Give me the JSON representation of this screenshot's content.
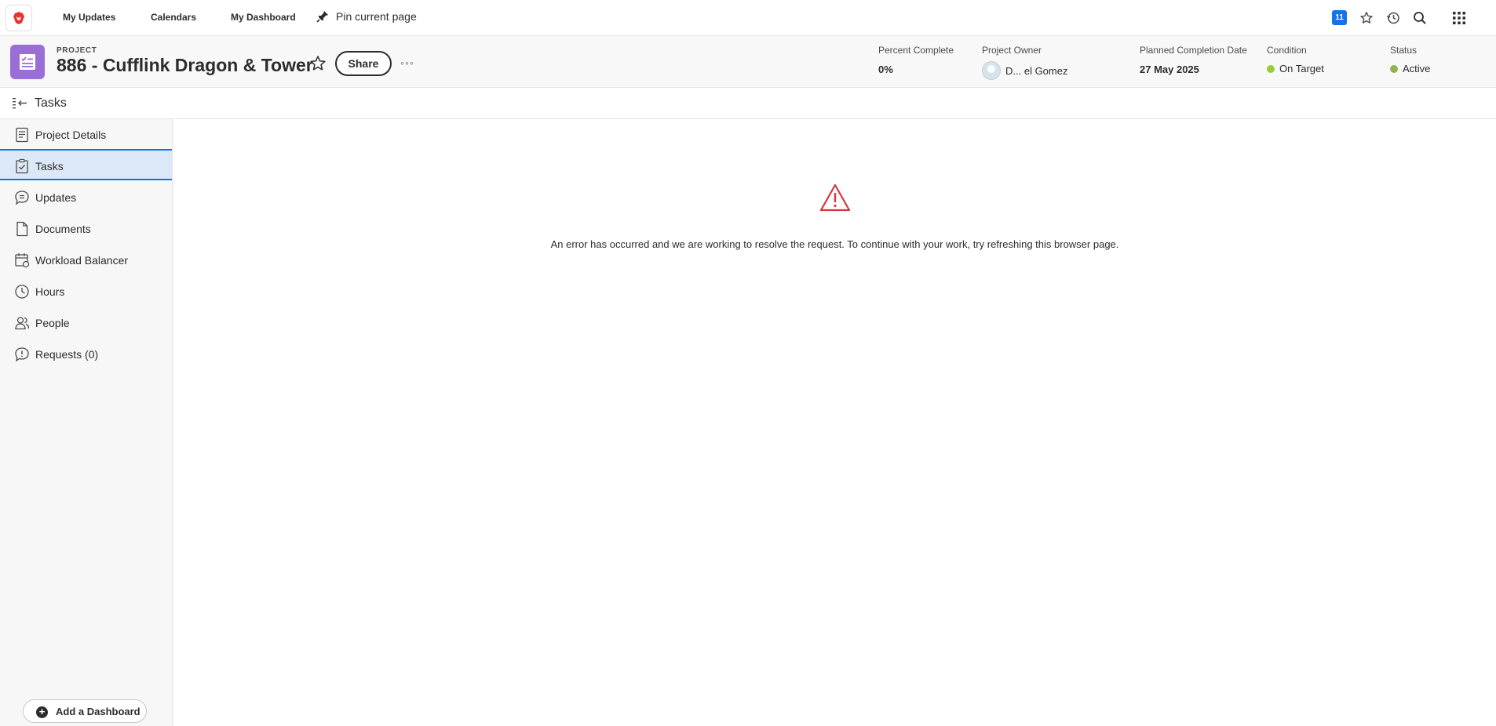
{
  "topnav": {
    "links": [
      "My Updates",
      "Calendars",
      "My Dashboard"
    ],
    "pin_label": "Pin current page",
    "badge": "11"
  },
  "project": {
    "kind": "PROJECT",
    "title": "886 - Cufflink Dragon & Tower",
    "share_label": "Share",
    "more_label": "◦◦◦",
    "fields": {
      "percent_complete": {
        "label": "Percent Complete",
        "value": "0%"
      },
      "owner": {
        "label": "Project Owner",
        "value": "D... el Gomez"
      },
      "planned_completion": {
        "label": "Planned Completion Date",
        "value": "27 May 2025"
      },
      "condition": {
        "label": "Condition",
        "value": "On Target",
        "color": "#9acd32"
      },
      "status": {
        "label": "Status",
        "value": "Active",
        "color": "#8db54e"
      }
    }
  },
  "section": {
    "title": "Tasks"
  },
  "sidebar": {
    "items": [
      {
        "label": "Project Details",
        "icon": "document-details-icon"
      },
      {
        "label": "Tasks",
        "icon": "clipboard-check-icon",
        "active": true
      },
      {
        "label": "Updates",
        "icon": "chat-bubble-icon"
      },
      {
        "label": "Documents",
        "icon": "file-icon"
      },
      {
        "label": "Workload Balancer",
        "icon": "calendar-user-icon"
      },
      {
        "label": "Hours",
        "icon": "clock-icon"
      },
      {
        "label": "People",
        "icon": "people-icon"
      },
      {
        "label": "Requests (0)",
        "icon": "request-bubble-icon"
      }
    ],
    "add_dashboard": "Add a Dashboard"
  },
  "main": {
    "error_message": "An error has occurred and we are working to resolve the request. To continue with your work, try refreshing this browser page."
  },
  "colors": {
    "accent": "#1473e6",
    "project_icon": "#9a6ed6",
    "error": "#d7373f"
  }
}
